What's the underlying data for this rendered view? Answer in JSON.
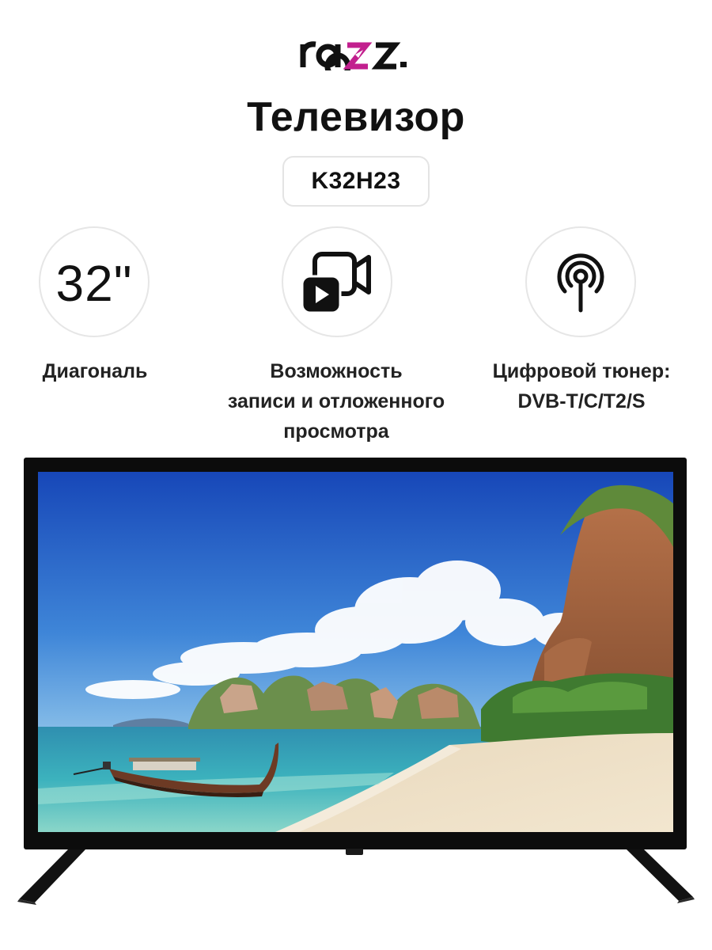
{
  "brand": {
    "logo_text": "razz",
    "accent_color": "#c21f8e"
  },
  "product": {
    "title": "Телевизор",
    "model": "K32H23"
  },
  "features": [
    {
      "icon": "diagonal",
      "value": "32\"",
      "label": "Диагональ"
    },
    {
      "icon": "video-record-icon",
      "label": "Возможность\nзаписи и отложенного\nпросмотра"
    },
    {
      "icon": "antenna-icon",
      "label": "Цифровой тюнер:\nDVB-T/C/T2/S"
    }
  ],
  "screen_image": "tropical beach landscape with longtail boat and limestone cliffs"
}
